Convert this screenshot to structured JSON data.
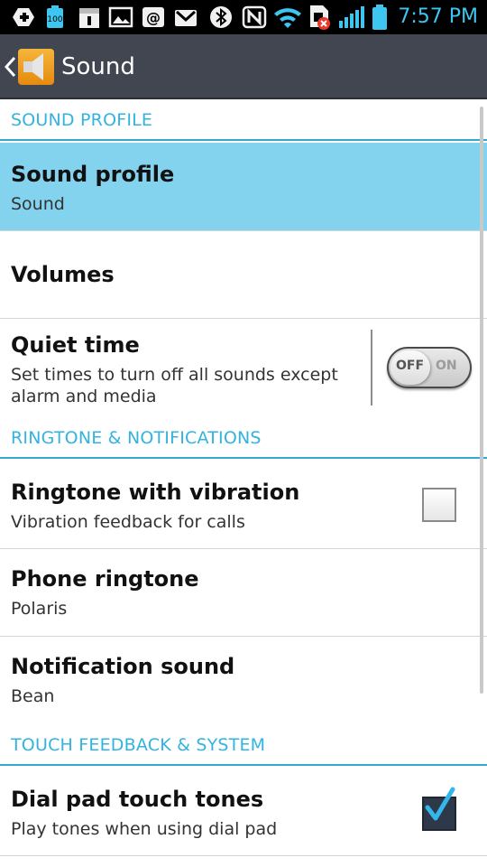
{
  "status_bar": {
    "time": "7:57 PM",
    "icons": [
      "add-icon",
      "battery-100-icon",
      "calendar-icon",
      "gallery-icon",
      "at-mail-icon",
      "gmail-icon",
      "bluetooth-icon",
      "nfc-icon",
      "wifi-icon",
      "sim-icon",
      "signal-icon",
      "battery-icon"
    ],
    "battery_badge": "100",
    "accent": "#3ec5f0"
  },
  "action_bar": {
    "title": "Sound",
    "icon": "speaker-icon"
  },
  "sections": {
    "sound_profile": "SOUND PROFILE",
    "ringtone": "RINGTONE & NOTIFICATIONS",
    "touch": "TOUCH FEEDBACK & SYSTEM"
  },
  "items": {
    "sound_profile": {
      "title": "Sound profile",
      "summary": "Sound"
    },
    "volumes": {
      "title": "Volumes"
    },
    "quiet_time": {
      "title": "Quiet time",
      "summary_line1": "Set times to turn off all sounds except",
      "summary_line2": "alarm and media",
      "toggle_off": "OFF",
      "toggle_on": "ON",
      "enabled": false
    },
    "ringtone_vibration": {
      "title": "Ringtone with vibration",
      "summary": "Vibration feedback for calls",
      "checked": false
    },
    "phone_ringtone": {
      "title": "Phone ringtone",
      "summary": "Polaris"
    },
    "notification_sound": {
      "title": "Notification sound",
      "summary": "Bean"
    },
    "dial_pad_tones": {
      "title": "Dial pad touch tones",
      "summary": "Play tones when using dial pad",
      "checked": true
    }
  },
  "colors": {
    "selected_row": "#83d3ef",
    "section_header_text": "#33b3e0",
    "action_bar": "#414651"
  }
}
